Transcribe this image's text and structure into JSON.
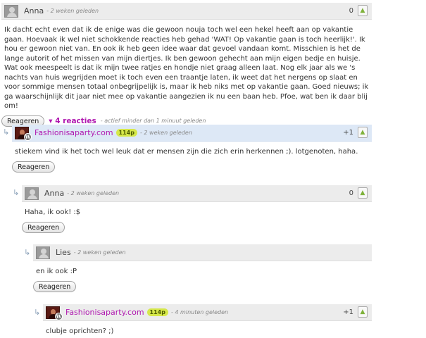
{
  "comments": [
    {
      "author": "Anna",
      "time": "- 2 weken geleden",
      "score": "0",
      "text": "Ik dacht echt even dat ik de enige was die gewoon nouja toch wel een hekel heeft aan op vakantie gaan. Hoevaak ik wel niet schokkende reacties heb gehad 'WAT! Op vakantie gaan is toch heerlijk!'. Ik hou er gewoon niet van. En ook ik heb geen idee waar dat gevoel vandaan komt. Misschien is het de lange autorit of het missen van mijn diertjes. Ik ben gewoon gehecht aan mijn eigen bedje en huisje. Wat ook meespeelt is dat ik mijn twee ratjes en hondje niet graag alleen laat. Nog elk jaar als we 's nachts van huis wegrijden moet ik toch even een traantje laten, ik weet dat het nergens op slaat en voor sommige mensen totaal onbegrijpelijk is, maar ik heb niks met op vakantie gaan. Goed nieuws; ik ga waarschijnlijk dit jaar niet mee op vakantie aangezien ik nu een baan heb. Pfoe, wat ben ik daar blij om!",
      "reply_label": "Reageren",
      "replies_toggle": "▾ 4 reacties",
      "activity": "- actief minder dan 1 minuut geleden"
    },
    {
      "author": "Fashionisaparty.com",
      "badge": "114p",
      "time": "- 2 weken geleden",
      "score": "+1",
      "text": "stiekem vind ik het toch wel leuk dat er mensen zijn die zich erin herkennen ;). lotgenoten, haha.",
      "reply_label": "Reageren"
    },
    {
      "author": "Anna",
      "time": "- 2 weken geleden",
      "score": "0",
      "text": "Haha, ik ook! :$",
      "reply_label": "Reageren"
    },
    {
      "author": "Lies",
      "time": "- 2 weken geleden",
      "text": "en ik ook :P",
      "reply_label": "Reageren"
    },
    {
      "author": "Fashionisaparty.com",
      "badge": "114p",
      "time": "- 4 minuten geleden",
      "score": "+1",
      "text": "clubje oprichten? ;)"
    }
  ],
  "icons": {
    "reply_arrow": "↳",
    "thumb": "👍",
    "wordpress": "W"
  }
}
